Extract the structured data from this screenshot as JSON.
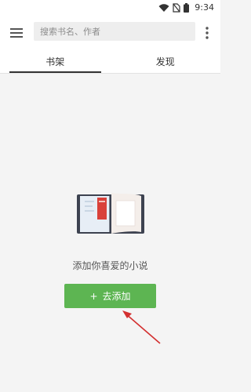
{
  "status_bar": {
    "time": "9:34"
  },
  "toolbar": {
    "search_placeholder": "搜索书名、作者"
  },
  "tabs": [
    {
      "label": "书架",
      "selected": true
    },
    {
      "label": "发现",
      "selected": false
    }
  ],
  "empty_state": {
    "message": "添加你喜爱的小说",
    "add_button_label": "去添加"
  },
  "colors": {
    "accent": "#5db552",
    "arrow": "#d32f2f"
  }
}
